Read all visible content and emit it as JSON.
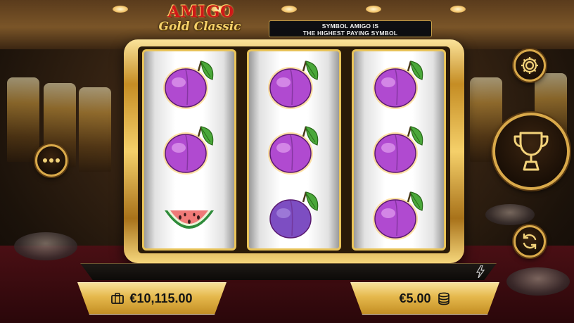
{
  "logo": {
    "line1": "AMIGO",
    "line2": "Gold Classic"
  },
  "banner": {
    "line1": "SYMBOL AMIGO IS",
    "line2": "THE HIGHEST PAYING SYMBOL"
  },
  "reels": [
    [
      "plum",
      "plum",
      "watermelon"
    ],
    [
      "plum",
      "plum",
      "purple-plum"
    ],
    [
      "plum",
      "plum",
      "plum"
    ]
  ],
  "balance": {
    "amount": "€10,115.00",
    "icon": "briefcase-icon"
  },
  "bet": {
    "amount": "€5.00",
    "icon": "coins-icon"
  },
  "buttons": {
    "settings": "gear-icon",
    "spin": "trophy-icon",
    "autoplay": "refresh-icon",
    "menu": "ellipsis-icon",
    "turbo": "lightning-icon"
  },
  "colors": {
    "gold": "#e5b84c",
    "plum": "#b04ad0",
    "dark": "#141414"
  }
}
